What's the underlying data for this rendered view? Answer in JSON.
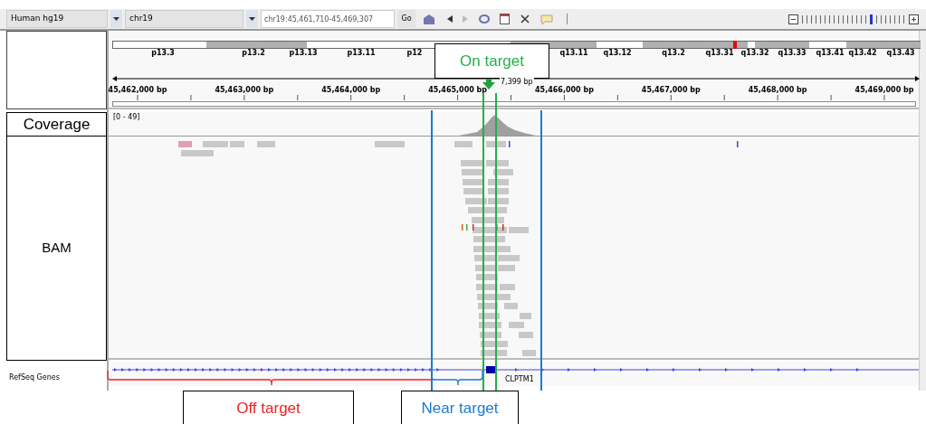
{
  "toolbar": {
    "genome": "Human hg19",
    "chromosome": "chr19",
    "locus": "chr19:45,461,710-45,469,307",
    "go": "Go",
    "zoom": {
      "level": 0.65
    }
  },
  "ideogram": {
    "bands": [
      "p13.3",
      "p13.2",
      "p13.13",
      "p13.11",
      "p12",
      "q13.11",
      "q13.12",
      "q13.2",
      "q13.31",
      "q13.32",
      "q13.33",
      "q13.41",
      "q13.42",
      "q13.43"
    ]
  },
  "ruler": {
    "span": "7,399 bp",
    "ticks": [
      "45,462,000 bp",
      "45,463,000 bp",
      "45,464,000 bp",
      "45,465,000 bp",
      "45,466,000 bp",
      "45,467,000 bp",
      "45,468,000 bp",
      "45,469,000 bp"
    ]
  },
  "tracks": [
    {
      "kind": "coverage",
      "name": "Coverage",
      "range": "[0 - 49]"
    },
    {
      "kind": "alignment",
      "name": "BAM"
    },
    {
      "kind": "genes",
      "name": "RefSeq Genes",
      "gene": "CLPTM1"
    }
  ],
  "annotations": {
    "on_target": "On target",
    "off_target": "Off target",
    "near_target": "Near target"
  }
}
